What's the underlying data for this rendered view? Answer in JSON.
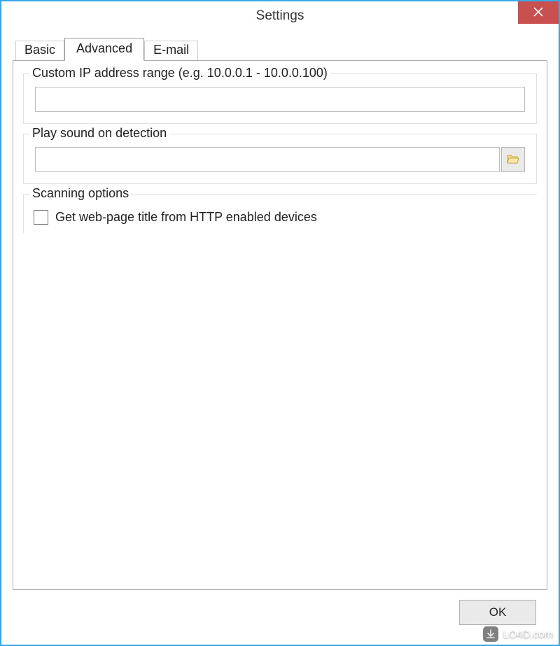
{
  "window": {
    "title": "Settings"
  },
  "tabs": {
    "basic": "Basic",
    "advanced": "Advanced",
    "email": "E-mail",
    "active": "advanced"
  },
  "groups": {
    "ip_range": {
      "legend": "Custom IP address range (e.g. 10.0.0.1 - 10.0.0.100)",
      "value": ""
    },
    "sound": {
      "legend": "Play sound on detection",
      "value": ""
    },
    "scanning": {
      "legend": "Scanning options",
      "checkbox_label": "Get web-page title from HTTP enabled devices",
      "checked": false
    }
  },
  "footer": {
    "ok_label": "OK"
  },
  "watermark": {
    "text": "LO4D.com"
  }
}
